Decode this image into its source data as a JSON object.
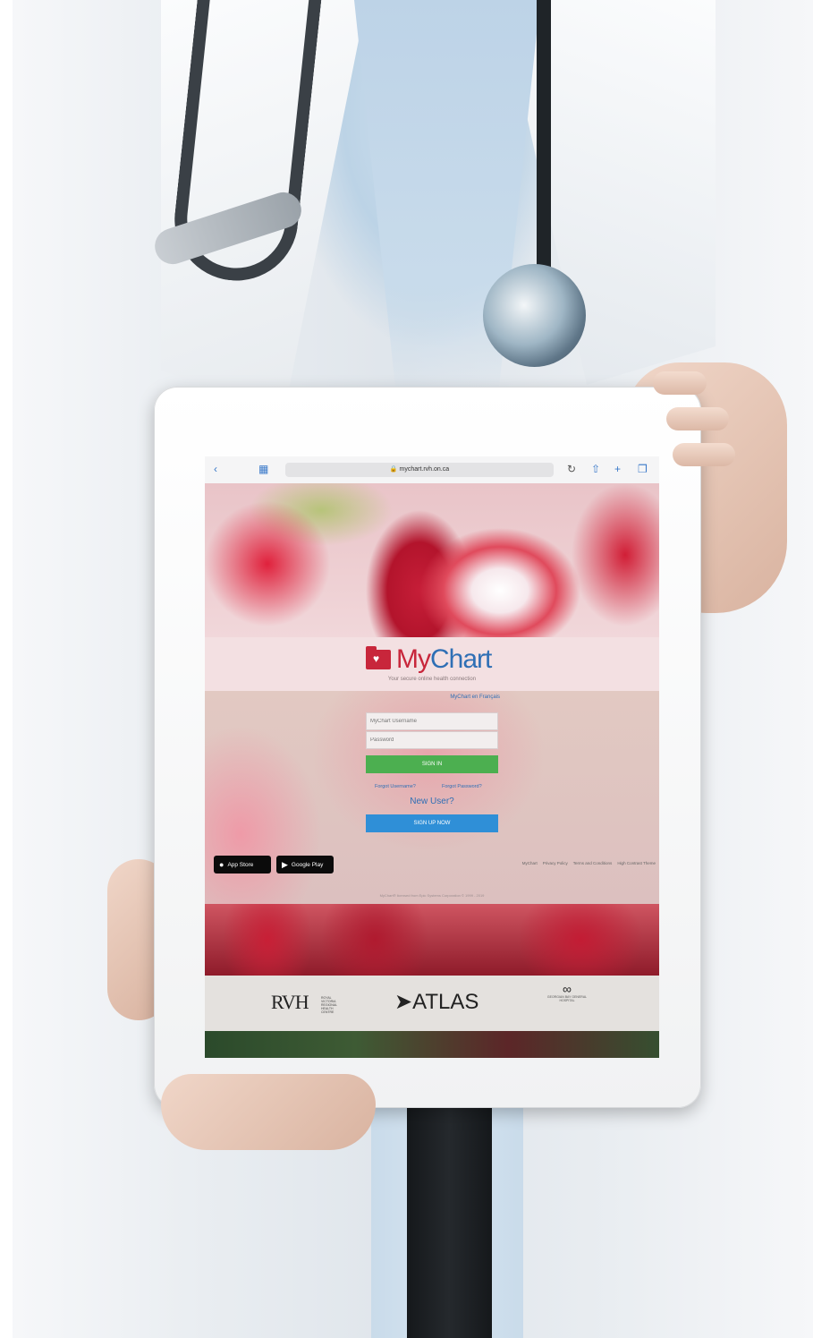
{
  "browser": {
    "url": "mychart.rvh.on.ca"
  },
  "mychart": {
    "logo_my": "My",
    "logo_chart": "Chart",
    "tagline": "Your secure online health connection",
    "signin_link": "MyChart en Français",
    "username_placeholder": "MyChart Username",
    "password_placeholder": "Password",
    "signin_button": "SIGN IN",
    "forgot_username": "Forgot Username?",
    "forgot_password": "Forgot Password?",
    "new_user": "New User?",
    "signup_button": "SIGN UP NOW",
    "app_store": "App Store",
    "google_play": "Google Play",
    "footer_links": [
      "MyChart",
      "Privacy Policy",
      "Terms and Conditions",
      "High Contrast Theme"
    ],
    "copyright": "MyChart® licensed from Epic Systems Corporation © 1999 - 2019"
  },
  "partners": {
    "rvh": "RVH",
    "rvh_sub": "ROYAL VICTORIA REGIONAL HEALTH CENTRE",
    "atlas": "ATLAS",
    "geo": "GEORGIAN BAY GENERAL HOSPITAL"
  },
  "colors": {
    "brand_red": "#c8263b",
    "brand_blue": "#2f6fb5",
    "signin_green": "#4caf50",
    "signup_blue": "#2f8fd7"
  }
}
